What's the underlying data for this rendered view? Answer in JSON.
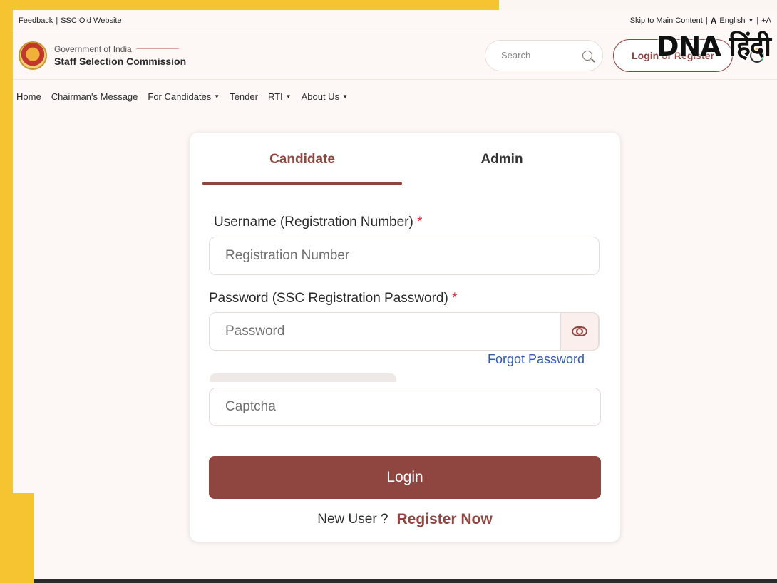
{
  "utility": {
    "feedback": "Feedback",
    "old_website": "SSC Old Website",
    "skip": "Skip to Main Content",
    "font_icon": "A",
    "language": "English",
    "font_increase": "+A"
  },
  "header": {
    "gov": "Government of India",
    "org": "Staff Selection Commission",
    "search_placeholder": "Search",
    "login_register": "Login or Register"
  },
  "overlay": {
    "dna_logo": "DNA हिंदी"
  },
  "nav": {
    "items": [
      "Home",
      "Chairman's Message",
      "For Candidates",
      "Tender",
      "RTI",
      "About Us"
    ]
  },
  "login": {
    "tabs": [
      "Candidate",
      "Admin"
    ],
    "username_label": "Username (Registration Number)",
    "username_placeholder": "Registration Number",
    "password_label": "Password (SSC Registration Password)",
    "password_placeholder": "Password",
    "required_mark": "*",
    "forgot_password": "Forgot Password",
    "captcha_placeholder": "Captcha",
    "login_button": "Login",
    "new_user": "New User ?",
    "register_now": "Register Now"
  },
  "colors": {
    "brand": "#8f4540",
    "link": "#2e5aab",
    "frame": "#f7c431"
  }
}
